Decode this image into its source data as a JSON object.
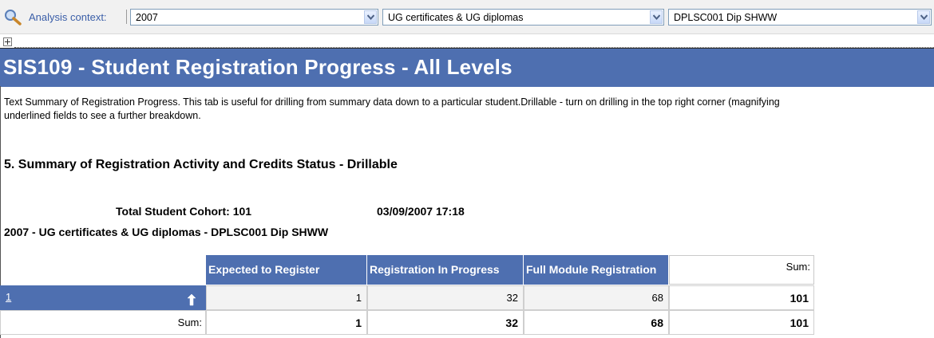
{
  "context_bar": {
    "label": "Analysis context:",
    "year": "2007",
    "programme_type": "UG certificates & UG diplomas",
    "programme": "DPLSC001 Dip SHWW"
  },
  "report": {
    "title": "SIS109 - Student Registration Progress - All Levels",
    "description_lines": [
      "Text Summary of Registration Progress. This tab is useful for drilling from summary data down to a particular student.Drillable - turn on drilling in the top right corner (magnifying",
      "underlined fields to see a further breakdown."
    ],
    "section_title": "5. Summary of Registration Activity and Credits Status - Drillable",
    "cohort": "Total Student Cohort: 101",
    "timestamp": "03/09/2007 17:18",
    "context_line": "2007 - UG certificates & UG diplomas - DPLSC001 Dip SHWW"
  },
  "table": {
    "columns": [
      "Expected to Register",
      "Registration In Progress",
      "Full Module Registration"
    ],
    "sum_header": "Sum:",
    "rows": [
      {
        "label": "1",
        "values": [
          "1",
          "32",
          "68"
        ],
        "sum": "101"
      }
    ],
    "sum_row": {
      "label": "Sum:",
      "values": [
        "1",
        "32",
        "68"
      ],
      "sum": "101"
    }
  },
  "colors": {
    "banner": "#4e6fb0",
    "header": "#4e6fb0",
    "link": "#3a5ea8"
  }
}
